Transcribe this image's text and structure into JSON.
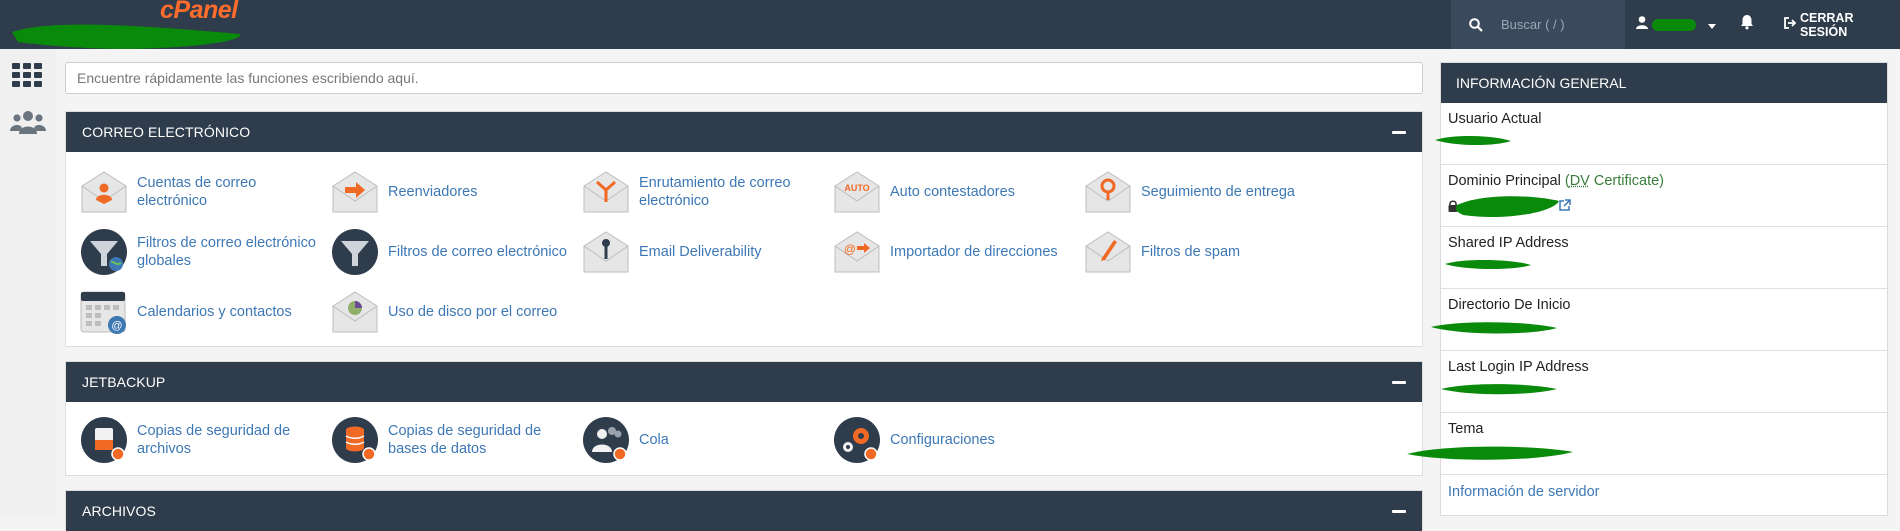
{
  "header": {
    "logo": "cPanel",
    "search_placeholder": "Buscar ( / )",
    "logout_label": "CERRAR SESIÓN"
  },
  "quick_search": {
    "placeholder": "Encuentre rápidamente las funciones escribiendo aquí."
  },
  "sections": {
    "email": {
      "title": "CORREO ELECTRÓNICO",
      "items": [
        {
          "label": "Cuentas de correo electrónico",
          "icon": "email-accounts-icon"
        },
        {
          "label": "Reenviadores",
          "icon": "forwarders-icon"
        },
        {
          "label": "Enrutamiento de correo electrónico",
          "icon": "email-routing-icon"
        },
        {
          "label": "Auto contestadores",
          "icon": "autoresponders-icon"
        },
        {
          "label": "Seguimiento de entrega",
          "icon": "track-delivery-icon"
        },
        {
          "label": "Filtros de correo electrónico globales",
          "icon": "global-email-filters-icon"
        },
        {
          "label": "Filtros de correo electrónico",
          "icon": "email-filters-icon"
        },
        {
          "label": "Email Deliverability",
          "icon": "email-deliverability-icon"
        },
        {
          "label": "Importador de direcciones",
          "icon": "address-importer-icon"
        },
        {
          "label": "Filtros de spam",
          "icon": "spam-filters-icon"
        },
        {
          "label": "Calendarios y contactos",
          "icon": "calendars-contacts-icon"
        },
        {
          "label": "Uso de disco por el correo",
          "icon": "email-disk-usage-icon"
        }
      ]
    },
    "jetbackup": {
      "title": "JETBACKUP",
      "items": [
        {
          "label": "Copias de seguridad de archivos",
          "icon": "file-backups-icon"
        },
        {
          "label": "Copias de seguridad de bases de datos",
          "icon": "database-backups-icon"
        },
        {
          "label": "Cola",
          "icon": "queue-icon"
        },
        {
          "label": "Configuraciones",
          "icon": "settings-gear-icon"
        }
      ]
    },
    "files": {
      "title": "ARCHIVOS"
    }
  },
  "general_info": {
    "title": "INFORMACIÓN GENERAL",
    "rows": {
      "current_user": "Usuario Actual",
      "primary_domain": "Dominio Principal",
      "dv_prefix": "(",
      "dv_abbr": "DV",
      "dv_suffix": " Certificate)",
      "shared_ip": "Shared IP Address",
      "home_dir": "Directorio De Inicio",
      "last_login_ip": "Last Login IP Address",
      "theme": "Tema"
    },
    "server_info_link": "Información de servidor"
  },
  "colors": {
    "topbar": "#2f3c4b",
    "accent": "#ff6c2c",
    "link": "#3d78b5",
    "redaction": "#0a8a0a"
  }
}
